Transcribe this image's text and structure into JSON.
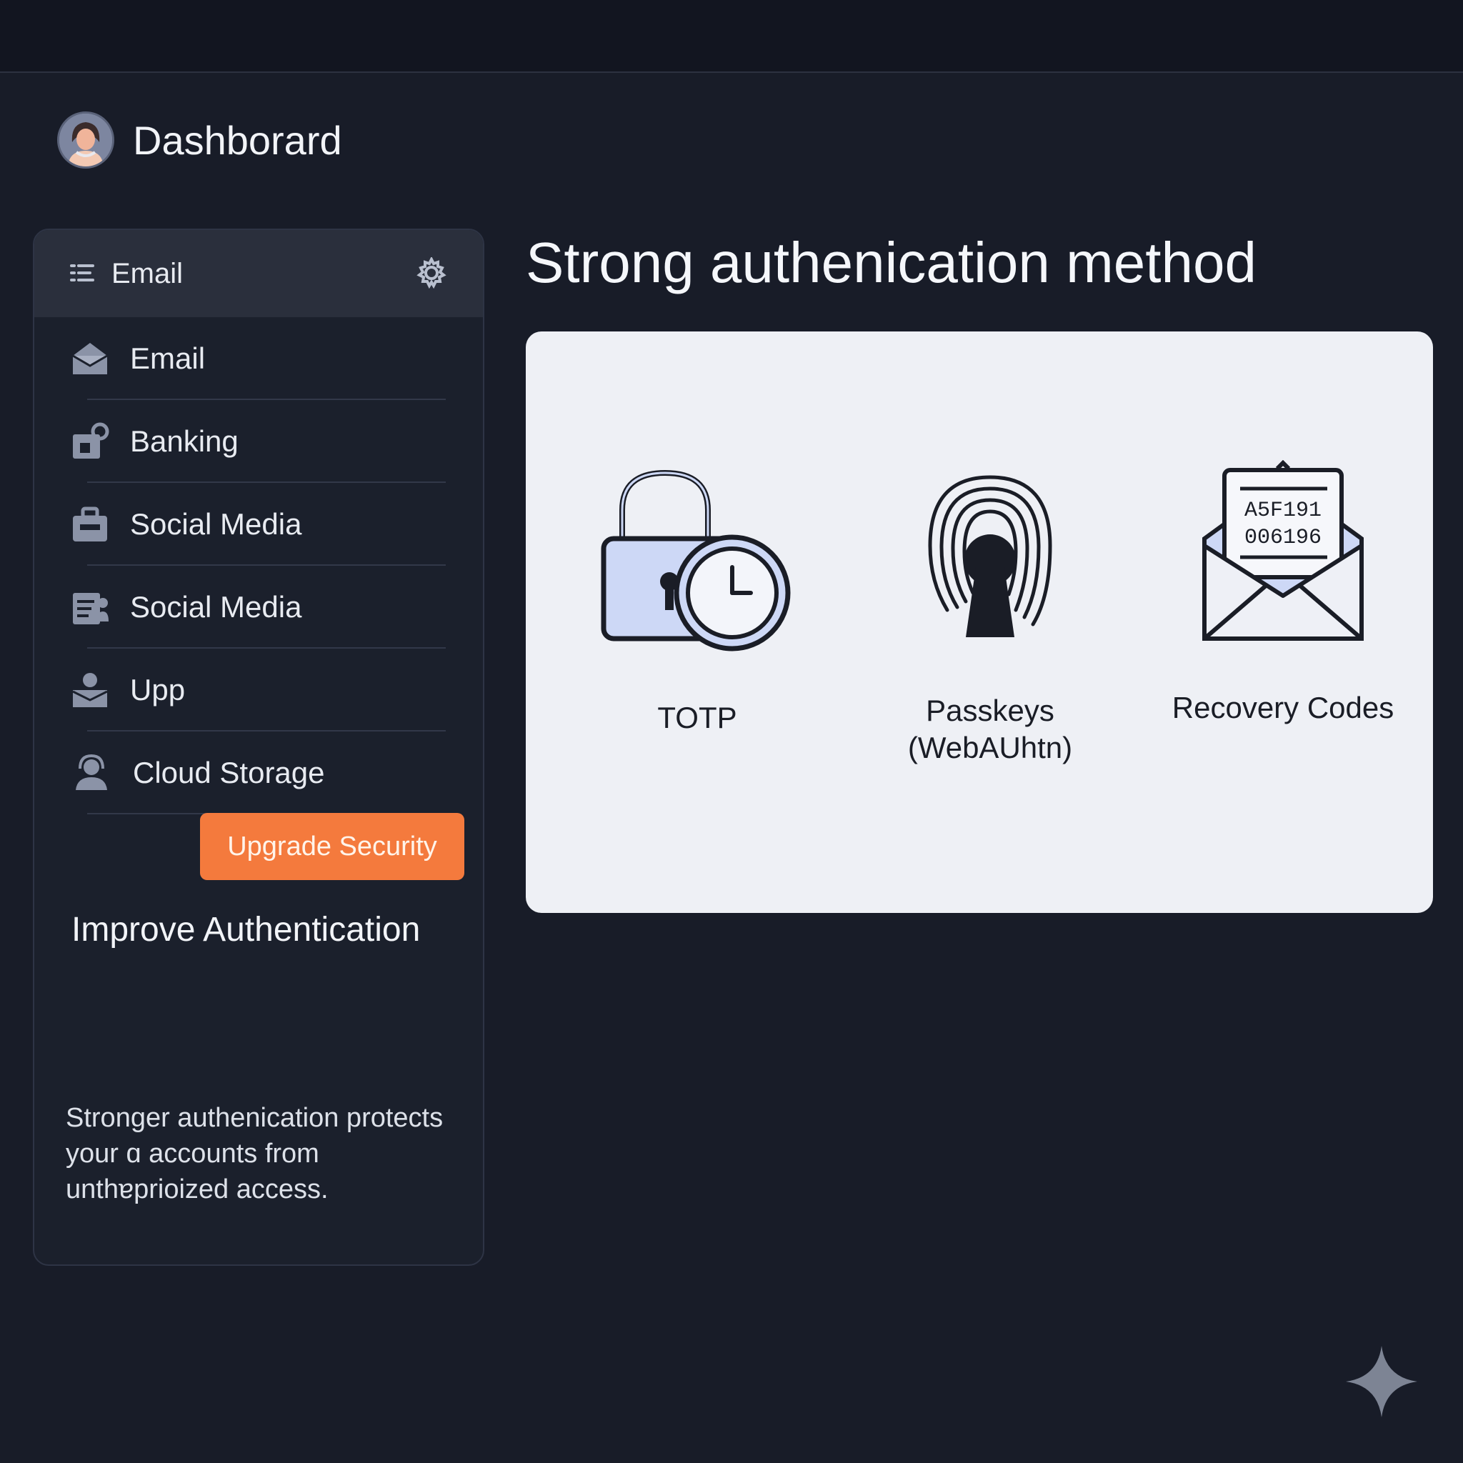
{
  "header": {
    "title": "Dashborard"
  },
  "sidebar": {
    "head_label": "Email",
    "items": [
      {
        "label": "Email",
        "icon": "envelope-open-icon"
      },
      {
        "label": "Banking",
        "icon": "bank-lock-icon"
      },
      {
        "label": "Social Media",
        "icon": "briefcase-icon"
      },
      {
        "label": "Social Media",
        "icon": "id-card-icon"
      },
      {
        "label": "Upp",
        "icon": "user-inbox-icon"
      },
      {
        "label": "Cloud Storage",
        "icon": "user-headset-icon"
      }
    ],
    "upgrade_button": "Upgrade Security",
    "improve_title": "Improve Authentication",
    "description": "Stronger authenication protects your ɑ accounts from unthɐprioized access."
  },
  "main": {
    "title": "Strong authenication method",
    "methods": [
      {
        "label": "TOTP",
        "icon": "lock-clock-icon"
      },
      {
        "label_line1": "Passkeys",
        "label_line2": "(WebAUhtn)",
        "icon": "fingerprint-keyhole-icon"
      },
      {
        "label": "Recovery Codes",
        "icon": "envelope-codes-icon",
        "code_line1": "A5F191",
        "code_line2": "006196"
      }
    ]
  },
  "colors": {
    "background": "#181c28",
    "accent": "#f47a3d",
    "card": "#eef0f5",
    "icon_fill": "#cdd8f6"
  }
}
